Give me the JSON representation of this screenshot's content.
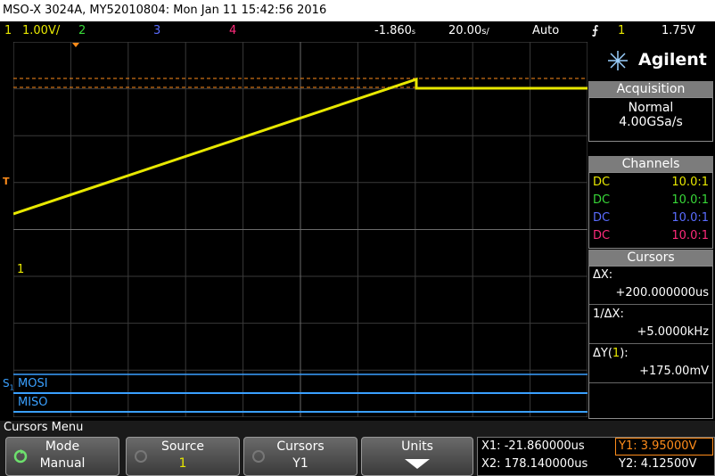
{
  "title": "MSO-X 3024A, MY52010804: Mon Jan 11 15:42:56 2016",
  "status": {
    "ch1_num": "1",
    "ch1_scale": "1.00V/",
    "ch2_num": "2",
    "ch3_num": "3",
    "ch4_num": "4",
    "time_offset": "-1.860",
    "time_offset_unit": "s",
    "time_scale": "20.00",
    "time_scale_unit": "s/",
    "trigger_mode": "Auto",
    "trigger_icon": "⨍",
    "trigger_source": "1",
    "trigger_level": "1.75V"
  },
  "brand": {
    "name": "Agilent"
  },
  "acquisition": {
    "header": "Acquisition",
    "mode": "Normal",
    "rate": "4.00GSa/s"
  },
  "channels": {
    "header": "Channels",
    "rows": [
      {
        "coupling": "DC",
        "ratio": "10.0:1",
        "color": "#e8e800"
      },
      {
        "coupling": "DC",
        "ratio": "10.0:1",
        "color": "#38d838"
      },
      {
        "coupling": "DC",
        "ratio": "10.0:1",
        "color": "#5a6cff"
      },
      {
        "coupling": "DC",
        "ratio": "10.0:1",
        "color": "#ff2a7a"
      }
    ]
  },
  "cursors": {
    "header": "Cursors",
    "dx_label": "ΔX:",
    "dx_value": "+200.000000us",
    "inv_dx_label": "1/ΔX:",
    "inv_dx_value": "+5.0000kHz",
    "dy_label_prefix": "ΔY(",
    "dy_label_ch": "1",
    "dy_label_suffix": "):",
    "dy_value": "+175.00mV"
  },
  "waveform": {
    "trigger_marker": "T",
    "ch1_marker": "1",
    "serial_label": "S",
    "serial_sub": "1",
    "mosi": "MOSI",
    "miso": "MISO"
  },
  "menu": {
    "title": "Cursors Menu",
    "mode_label": "Mode",
    "mode_value": "Manual",
    "source_label": "Source",
    "source_value": "1",
    "cursors_label": "Cursors",
    "cursors_value": "Y1",
    "units_label": "Units",
    "x1": "X1: -21.860000us",
    "x2": "X2: 178.140000us",
    "y1": "Y1: 3.95000V",
    "y2": "Y2: 4.12500V"
  },
  "colors": {
    "ch1": "#e8e800",
    "ch2": "#38d838",
    "ch3": "#5a6cff",
    "ch4": "#ff2a7a",
    "cursor": "#ff8c1a",
    "serial": "#3aa0ff"
  }
}
